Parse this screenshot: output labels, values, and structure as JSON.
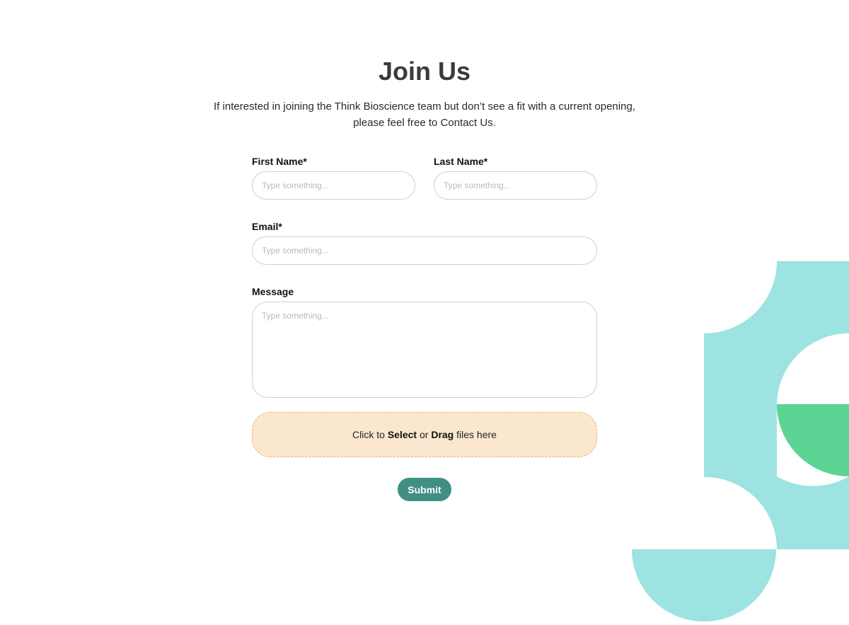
{
  "page": {
    "title": "Join Us",
    "intro_line1": "If interested in joining the Think Bioscience team but don’t see a fit with a current opening,",
    "intro_line2": "please feel free to Contact Us."
  },
  "form": {
    "first_name": {
      "label": "First Name*",
      "placeholder": "Type something...",
      "value": ""
    },
    "last_name": {
      "label": "Last Name*",
      "placeholder": "Type something...",
      "value": ""
    },
    "email": {
      "label": "Email*",
      "placeholder": "Type something...",
      "value": ""
    },
    "message": {
      "label": "Message",
      "placeholder": "Type something...",
      "value": ""
    },
    "upload": {
      "prefix": "Click to ",
      "select": "Select",
      "middle": " or ",
      "drag": "Drag",
      "suffix": " files here"
    },
    "submit_label": "Submit"
  },
  "colors": {
    "accent_teal": "#3f8f85",
    "dropzone_fill": "#fbe7cf",
    "dropzone_border": "#f0b35c",
    "decor_light_teal": "#9ce3e1",
    "decor_green": "#5cd494"
  }
}
